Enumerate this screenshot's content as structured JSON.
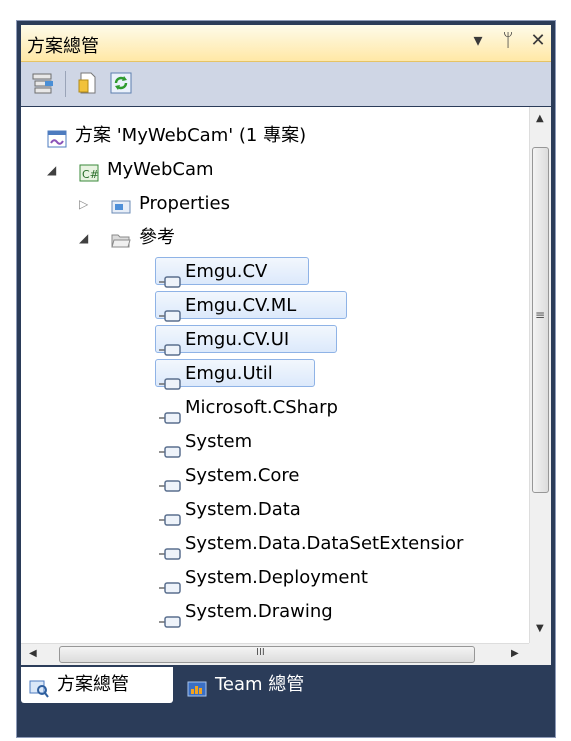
{
  "panel": {
    "title": "方案總管",
    "buttons": {
      "dropdown": "▾",
      "pin": "ᛘ",
      "close": "✕"
    }
  },
  "tree": {
    "solution": "方案 'MyWebCam' (1 專案)",
    "project": "MyWebCam",
    "properties": "Properties",
    "references": "參考",
    "refs": [
      "Emgu.CV",
      "Emgu.CV.ML",
      "Emgu.CV.UI",
      "Emgu.Util",
      "Microsoft.CSharp",
      "System",
      "System.Core",
      "System.Data",
      "System.Data.DataSetExtensior",
      "System.Deployment",
      "System.Drawing"
    ],
    "selected_count": 4
  },
  "scroll": {
    "grip": "≡",
    "hgrip": "III",
    "up": "▲",
    "down": "▼",
    "left": "◀",
    "right": "▶"
  },
  "tabs": {
    "solution_explorer": "方案總管",
    "team_explorer": "Team 總管"
  },
  "colors": {
    "accent": "#2b3c59",
    "title_bg": "#ffe8a6",
    "selection_border": "#8fb3e6"
  }
}
